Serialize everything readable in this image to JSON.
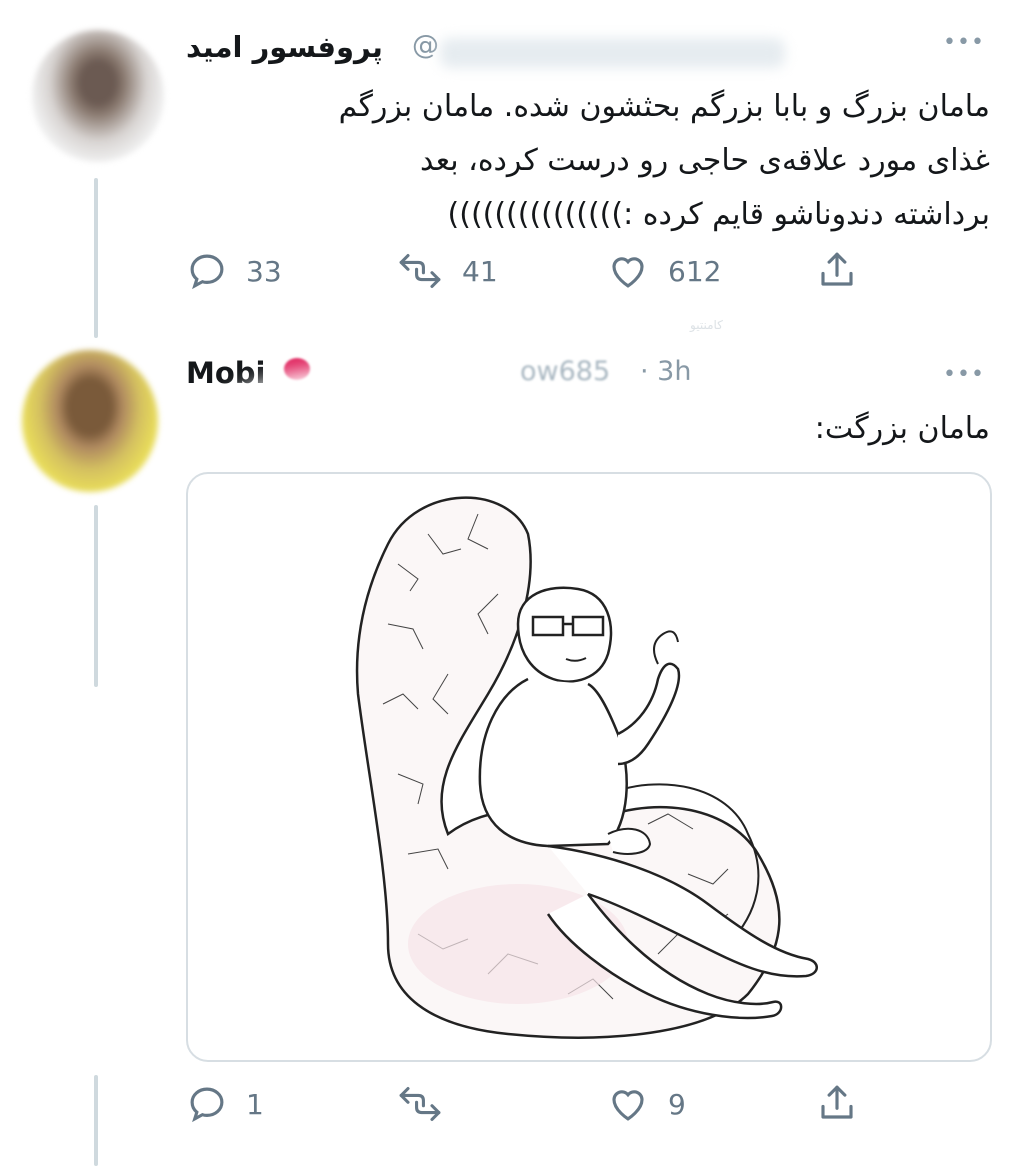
{
  "tweets": [
    {
      "display_name": "پروفسور امید",
      "handle": "@",
      "text_lines": [
        "مامان بزرگ و بابا بزرگم بحثشون شده. مامان بزرگم",
        "غذای مورد علاقه‌ی حاجی رو درست کرده، بعد",
        "برداشته دندوناشو قایم کرده :)))))))))))))))"
      ],
      "actions": {
        "reply_count": "33",
        "retweet_count": "41",
        "like_count": "612"
      }
    },
    {
      "display_name": "Mobi",
      "handle_fragment": "ow685",
      "time": "· 3h",
      "text": "مامان بزرگت:",
      "media": {
        "description_icon": "wojak-brain-chair-meme"
      },
      "actions": {
        "reply_count": "1",
        "retweet_count": "",
        "like_count": "9"
      }
    }
  ],
  "watermark": "کامنتیو",
  "icons": {
    "reply": "reply-icon",
    "retweet": "retweet-icon",
    "like": "heart-icon",
    "share": "share-icon",
    "more": "more-icon",
    "verified_badge": "red-badge-icon"
  },
  "colors": {
    "text": "#14171a",
    "muted": "#657786",
    "thread_line": "#cfd9de",
    "border": "#d7dee3"
  }
}
